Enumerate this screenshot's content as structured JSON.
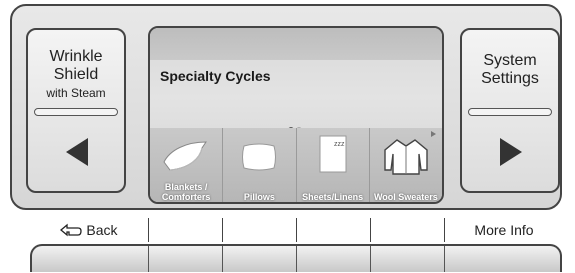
{
  "left_button": {
    "line1": "Wrinkle",
    "line2": "Shield",
    "line3": "with Steam",
    "icon": "left-arrow-icon"
  },
  "right_button": {
    "line1": "System",
    "line2": "Settings",
    "icon": "right-arrow-icon"
  },
  "screen": {
    "title": "Specialty Cycles",
    "page_indicator": {
      "current": 1,
      "total": 2
    },
    "cycles": [
      {
        "label_line1": "Blankets /",
        "label_line2": "Comforters",
        "icon": "blanket-icon"
      },
      {
        "label_line1": "",
        "label_line2": "Pillows",
        "icon": "pillow-icon"
      },
      {
        "label_line1": "",
        "label_line2": "Sheets/Linens",
        "icon": "sheets-icon"
      },
      {
        "label_line1": "",
        "label_line2": "Wool Sweaters",
        "icon": "sweater-icon"
      }
    ]
  },
  "soft_keys": {
    "back": "Back",
    "more_info": "More Info"
  },
  "colors": {
    "bezel": "#d6d6d6",
    "outline": "#444444",
    "tile": "#bdbdbd",
    "label": "#ffffff"
  }
}
